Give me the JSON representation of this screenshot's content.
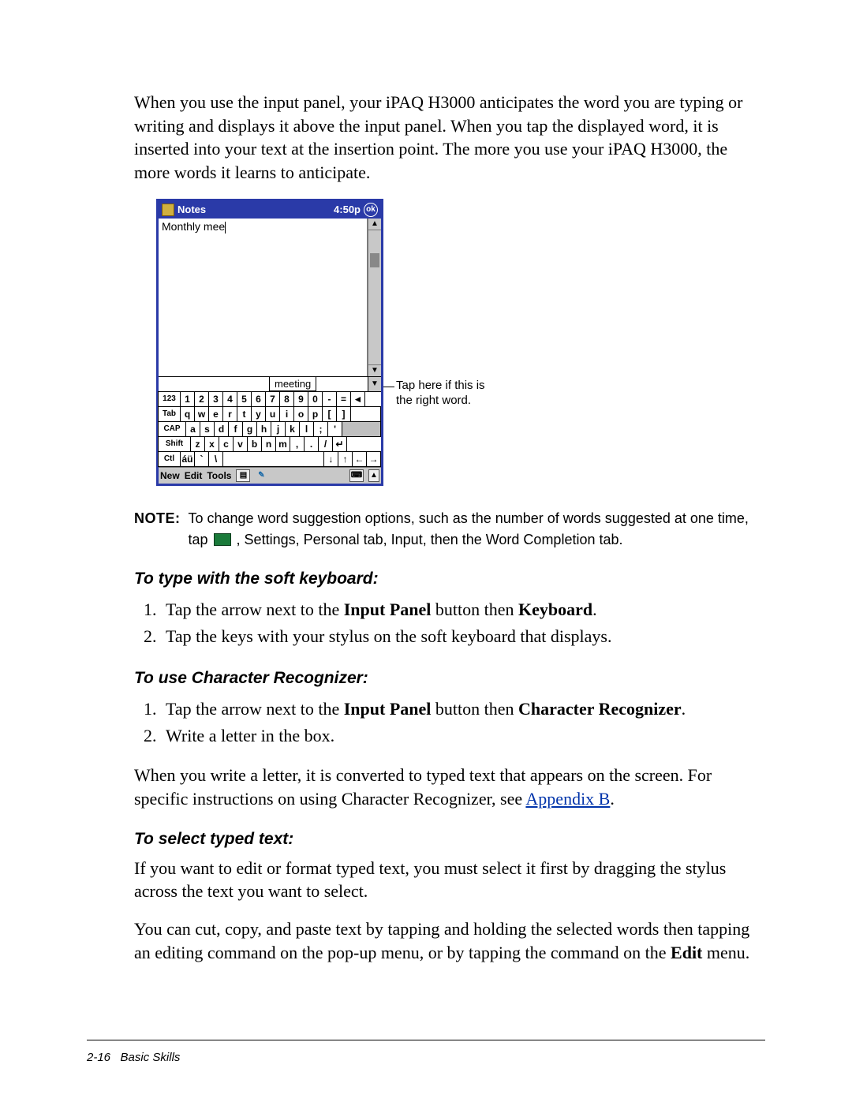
{
  "intro": "When you use the input panel, your iPAQ H3000 anticipates the word you are typing or writing and displays it above the input panel. When you tap the displayed word, it is inserted into your text at the insertion point. The more you use your iPAQ H3000, the more words it learns to anticipate.",
  "device": {
    "title": "Notes",
    "time": "4:50p",
    "ok": "ok",
    "typed": "Monthly mee",
    "suggestion": "meeting",
    "keyboard": {
      "row1": [
        "123",
        "1",
        "2",
        "3",
        "4",
        "5",
        "6",
        "7",
        "8",
        "9",
        "0",
        "-",
        "=",
        "◄"
      ],
      "row2": [
        "Tab",
        "q",
        "w",
        "e",
        "r",
        "t",
        "y",
        "u",
        "i",
        "o",
        "p",
        "[",
        "]"
      ],
      "row3": [
        "CAP",
        "a",
        "s",
        "d",
        "f",
        "g",
        "h",
        "j",
        "k",
        "l",
        ";",
        "'"
      ],
      "row4": [
        "Shift",
        "z",
        "x",
        "c",
        "v",
        "b",
        "n",
        "m",
        ",",
        ".",
        "/",
        "↵"
      ],
      "row5": [
        "Ctl",
        "áü",
        "`",
        "\\",
        " ",
        "↓",
        "↑",
        "←",
        "→"
      ]
    },
    "menu": {
      "new": "New",
      "edit": "Edit",
      "tools": "Tools"
    }
  },
  "callout": {
    "l1": "Tap here if this is",
    "l2": "the right word."
  },
  "note": {
    "label": "NOTE:",
    "text_a": "To change word suggestion options, such as the number of words suggested at one time, tap ",
    "text_b": ", Settings, Personal tab, Input, then the Word Completion tab."
  },
  "h1": "To type with the soft keyboard:",
  "steps1": {
    "s1a": "Tap the arrow next to the ",
    "s1b": "Input Panel",
    "s1c": " button then ",
    "s1d": "Keyboard",
    "s1e": ".",
    "s2": "Tap the keys with your stylus on the soft keyboard that displays."
  },
  "h2": "To use Character Recognizer:",
  "steps2": {
    "s1a": "Tap the arrow next to the ",
    "s1b": "Input Panel",
    "s1c": " button then ",
    "s1d": "Character Recognizer",
    "s1e": ".",
    "s2": "Write a letter in the box."
  },
  "para2a": "When you write a letter, it is converted to typed text that appears on the screen. For specific instructions on using Character Recognizer, see ",
  "para2link": "Appendix B",
  "para2b": ".",
  "h3": "To select typed text:",
  "para3": "If you want to edit or format typed text, you must select it first by dragging the stylus across the text you want to select.",
  "para4a": "You can cut, copy, and paste text by tapping and holding the selected words then tapping an editing command on the pop-up menu, or by tapping the command on the ",
  "para4b": "Edit",
  "para4c": " menu.",
  "footer": {
    "page": "2-16",
    "title": "Basic Skills"
  }
}
